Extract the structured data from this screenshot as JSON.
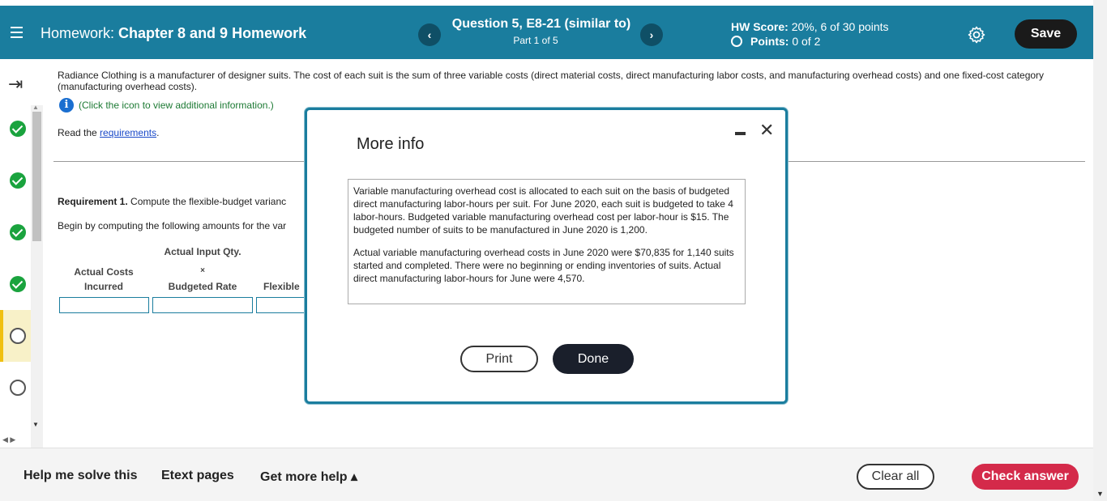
{
  "header": {
    "hw_prefix": "Homework: ",
    "hw_name": "Chapter 8 and 9 Homework",
    "question_title": "Question 5, E8-21 (similar to)",
    "question_part": "Part 1 of 5",
    "hw_score_label": "HW Score: ",
    "hw_score_value": "20%, 6 of 30 points",
    "points_label": "Points: ",
    "points_value": "0 of 2",
    "save_label": "Save",
    "prev_glyph": "‹",
    "next_glyph": "›"
  },
  "sidebar": {
    "questions": [
      {
        "status": "correct"
      },
      {
        "status": "correct"
      },
      {
        "status": "correct"
      },
      {
        "status": "correct"
      },
      {
        "status": "current"
      },
      {
        "status": "open"
      }
    ]
  },
  "main": {
    "intro_text": "Radiance Clothing is a manufacturer of designer suits. The cost of each suit is the sum of three variable costs (direct material costs, direct manufacturing labor costs, and manufacturing overhead costs) and one fixed-cost category (manufacturing overhead costs).",
    "info_text": "(Click the icon to view additional information.)",
    "read_prefix": "Read the ",
    "read_link": "requirements",
    "read_suffix": ".",
    "req1_label": "Requirement 1.",
    "req1_text": " Compute the flexible-budget varianc",
    "begin_text": "Begin by computing the following amounts for the var",
    "col_actual_input": "Actual Input Qty.",
    "col_actual_costs": "Actual Costs",
    "col_incurred": "Incurred",
    "col_times": "×",
    "col_budgeted_rate": "Budgeted Rate",
    "col_flexible": "Flexible"
  },
  "dialog": {
    "title": "More info",
    "para1": "Variable manufacturing overhead cost is allocated to each suit on the basis of budgeted direct manufacturing labor-hours per suit. For June 2020, each suit is budgeted to take 4 labor-hours. Budgeted variable manufacturing overhead cost per labor-hour is $15. The budgeted number of suits to be manufactured in June 2020 is 1,200.",
    "para2": "Actual variable manufacturing overhead costs in June 2020 were $70,835 for 1,140 suits started and completed. There were no beginning or ending inventories of suits. Actual direct manufacturing labor-hours for June were 4,570.",
    "print_label": "Print",
    "done_label": "Done"
  },
  "footer": {
    "help_label": "Help me solve this",
    "etext_label": "Etext pages",
    "more_help_label": "Get more help ▴",
    "clear_label": "Clear all",
    "check_label": "Check answer"
  },
  "colors": {
    "header_bg": "#1a7d9e",
    "correct": "#1aa33e",
    "check_btn": "#d42a4a"
  }
}
